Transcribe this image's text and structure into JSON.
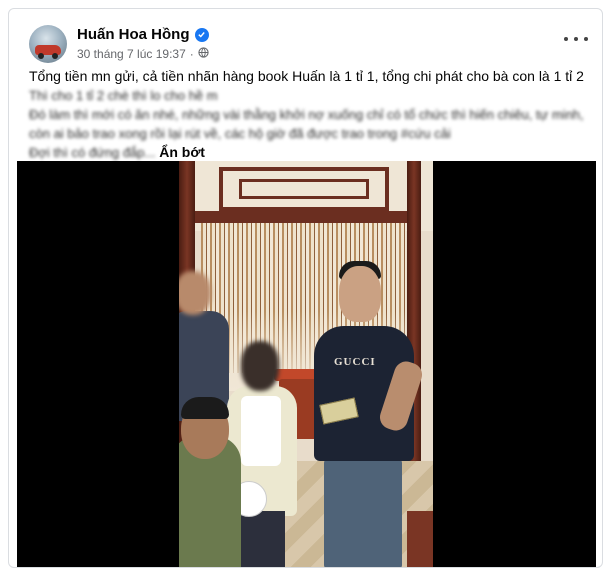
{
  "post": {
    "author": "Huấn Hoa Hồng",
    "timestamp": "30 tháng 7 lúc 19:37",
    "dot": "·",
    "verified_icon": "verified-badge-icon",
    "privacy_icon": "globe-icon",
    "more_icon": "more-options-icon",
    "text_lines": [
      "Tổng tiền mn gửi, cả tiền nhãn hàng book Huấn là 1 tỉ 1, tổng chi phát cho bà con là 1 tỉ 2",
      "Thì cho 1 tỉ 2 chè thì lo cho hề m",
      "Đó làm thì mới có ăn nhé, những vài thằng khởi nợ xuống chỉ có tổ chức thì hiến chiêu, tự minh,",
      "còn ai bảo trao xong rồi lại rút về, các hộ giờ đã được trao trong #cứu cải",
      "Đợi thì có đứng đắp..."
    ],
    "see_less": "Ẩn bớt"
  },
  "video": {
    "shirt_brand": "GUCCI"
  },
  "colors": {
    "link_blue": "#1877f2",
    "meta_gray": "#65676b",
    "text": "#050505"
  }
}
